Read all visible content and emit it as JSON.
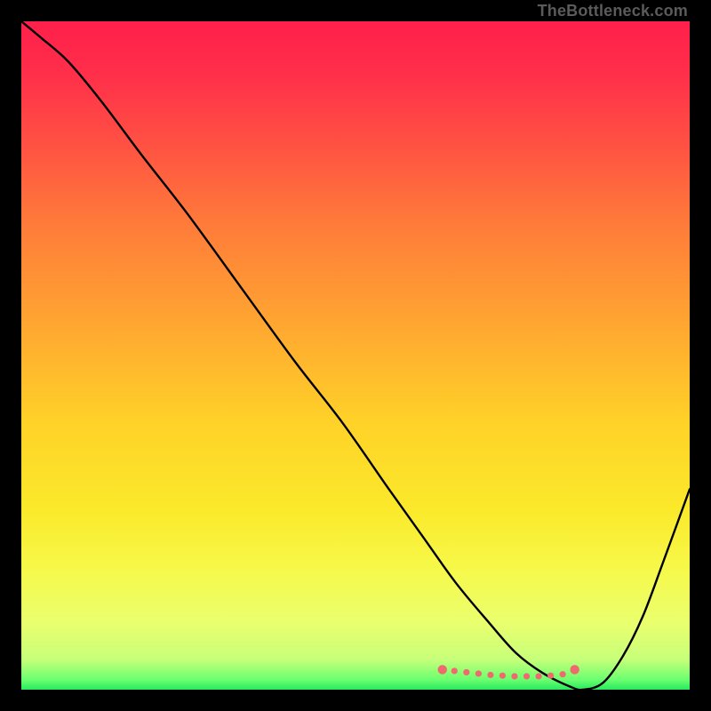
{
  "watermark": "TheBottleneck.com",
  "gradient_stops": [
    {
      "offset": 0.0,
      "color": "#ff1f4b"
    },
    {
      "offset": 0.08,
      "color": "#ff2f4a"
    },
    {
      "offset": 0.18,
      "color": "#ff5043"
    },
    {
      "offset": 0.3,
      "color": "#ff7a3a"
    },
    {
      "offset": 0.45,
      "color": "#ffa531"
    },
    {
      "offset": 0.6,
      "color": "#ffd228"
    },
    {
      "offset": 0.73,
      "color": "#fbe92a"
    },
    {
      "offset": 0.82,
      "color": "#f6f94a"
    },
    {
      "offset": 0.9,
      "color": "#eaff6e"
    },
    {
      "offset": 0.955,
      "color": "#c7ff7a"
    },
    {
      "offset": 0.985,
      "color": "#6bff6f"
    },
    {
      "offset": 1.0,
      "color": "#28e85e"
    }
  ],
  "chart_data": {
    "type": "line",
    "title": "",
    "xlabel": "",
    "ylabel": "",
    "xlim": [
      0,
      1
    ],
    "ylim": [
      0,
      1
    ],
    "series": [
      {
        "name": "curve-main",
        "color": "#000000",
        "x": [
          0.0,
          0.03,
          0.07,
          0.12,
          0.18,
          0.25,
          0.33,
          0.41,
          0.48,
          0.55,
          0.6,
          0.65,
          0.7,
          0.74,
          0.78,
          0.82,
          0.84,
          0.87,
          0.9,
          0.93,
          0.96,
          1.0
        ],
        "y": [
          1.0,
          0.975,
          0.94,
          0.88,
          0.8,
          0.71,
          0.6,
          0.49,
          0.4,
          0.3,
          0.23,
          0.16,
          0.1,
          0.055,
          0.025,
          0.005,
          0.0,
          0.01,
          0.05,
          0.11,
          0.19,
          0.3
        ]
      },
      {
        "name": "marker-band",
        "color": "#ef6a6f",
        "x": [
          0.63,
          0.648,
          0.666,
          0.684,
          0.702,
          0.72,
          0.738,
          0.756,
          0.774,
          0.792,
          0.81,
          0.828
        ],
        "y": [
          0.03,
          0.028,
          0.026,
          0.024,
          0.022,
          0.021,
          0.02,
          0.02,
          0.02,
          0.021,
          0.023,
          0.03
        ]
      }
    ]
  }
}
